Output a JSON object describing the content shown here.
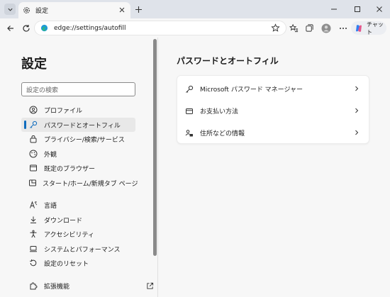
{
  "tab": {
    "title": "設定"
  },
  "address": {
    "url": "edge://settings/autofill"
  },
  "copilot": {
    "label": "チャット"
  },
  "sidebar": {
    "title": "設定",
    "search_placeholder": "設定の検索",
    "items": [
      {
        "label": "プロファイル"
      },
      {
        "label": "パスワードとオートフィル"
      },
      {
        "label": "プライバシー/検索/サービス"
      },
      {
        "label": "外観"
      },
      {
        "label": "既定のブラウザー"
      },
      {
        "label": "スタート/ホーム/新規タブ ページ"
      },
      {
        "label": "言語"
      },
      {
        "label": "ダウンロード"
      },
      {
        "label": "アクセシビリティ"
      },
      {
        "label": "システムとパフォーマンス"
      },
      {
        "label": "設定のリセット"
      },
      {
        "label": "拡張機能"
      }
    ]
  },
  "main": {
    "title": "パスワードとオートフィル",
    "rows": [
      {
        "label": "Microsoft パスワード マネージャー"
      },
      {
        "label": "お支払い方法"
      },
      {
        "label": "住所などの情報"
      }
    ]
  },
  "colors": {
    "accent": "#0f6cbd"
  }
}
